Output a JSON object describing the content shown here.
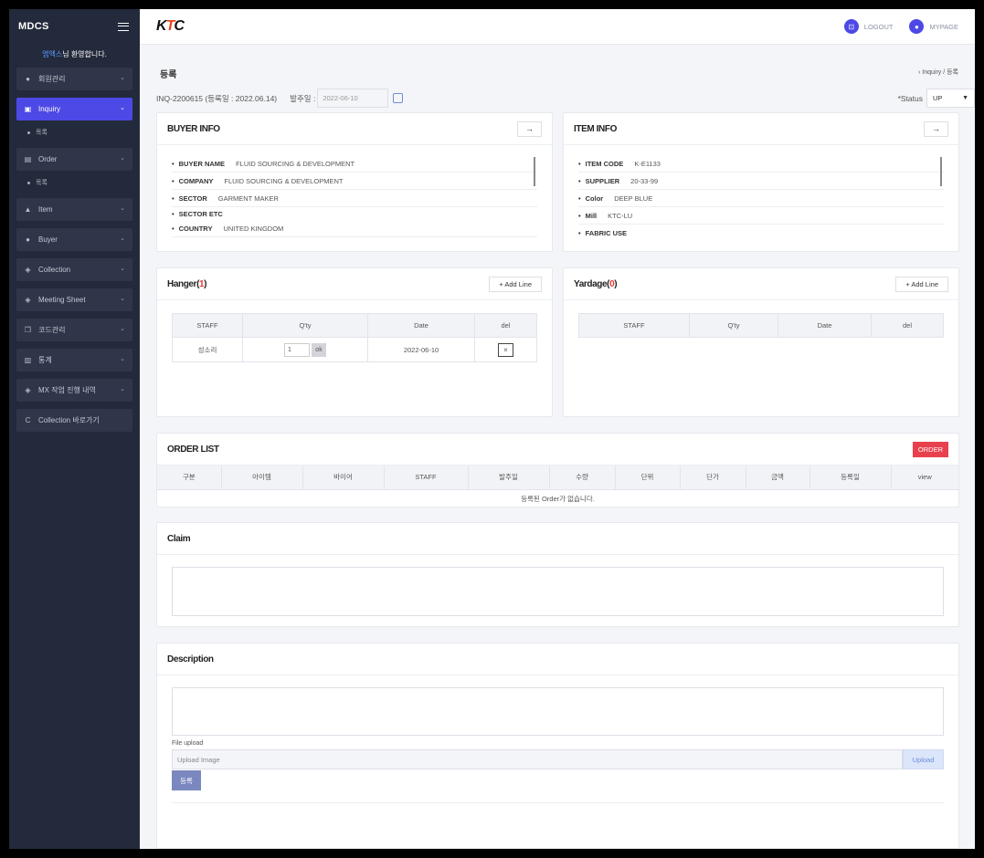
{
  "sidebar": {
    "brand": "MDCS",
    "welcome_user": "엠엑스",
    "welcome_text": "님 환영합니다.",
    "items": [
      {
        "label": "회원관리",
        "icon": "user-circle-icon"
      },
      {
        "label": "Inquiry",
        "icon": "clipboard-icon",
        "active": true,
        "sub": "목록"
      },
      {
        "label": "Order",
        "icon": "list-icon",
        "sub": "목록"
      },
      {
        "label": "Item",
        "icon": "hanger-icon"
      },
      {
        "label": "Buyer",
        "icon": "person-icon"
      },
      {
        "label": "Collection",
        "icon": "box-icon"
      },
      {
        "label": "Meeting Sheet",
        "icon": "box-icon"
      },
      {
        "label": "코드관리",
        "icon": "copy-icon"
      },
      {
        "label": "통계",
        "icon": "bar-chart-icon"
      },
      {
        "label": "MX 작업 진행 내역",
        "icon": "box-icon"
      },
      {
        "label": "Collection 바로가기",
        "icon": "c-icon"
      }
    ]
  },
  "header": {
    "logo": "KTC",
    "logout": "LOGOUT",
    "mypage": "MYPAGE"
  },
  "page": {
    "title": "등록",
    "breadcrumb": "Inquiry / 등록",
    "inquiry_no": "INQ-2200615 (등록일 : 2022.06.14)",
    "order_date_label": "발주일 :",
    "order_date_value": "2022-06-10",
    "status_label": "*Status",
    "status_value": "UP"
  },
  "buyer_info": {
    "title": "BUYER INFO",
    "rows": [
      {
        "key": "BUYER NAME",
        "value": "FLUID SOURCING & DEVELOPMENT"
      },
      {
        "key": "COMPANY",
        "value": "FLUID SOURCING & DEVELOPMENT"
      },
      {
        "key": "SECTOR",
        "value": "GARMENT MAKER"
      },
      {
        "key": "SECTOR ETC",
        "value": ""
      },
      {
        "key": "COUNTRY",
        "value": "UNITED KINGDOM"
      }
    ]
  },
  "item_info": {
    "title": "ITEM INFO",
    "rows": [
      {
        "key": "ITEM CODE",
        "value": "K-E1133"
      },
      {
        "key": "SUPPLIER",
        "value": "20-33-99"
      },
      {
        "key": "Color",
        "value": "DEEP BLUE"
      },
      {
        "key": "Mill",
        "value": "KTC-LU"
      },
      {
        "key": "FABRIC USE",
        "value": ""
      }
    ]
  },
  "hanger": {
    "title": "Hanger",
    "count": "1",
    "add_line": "+ Add Line",
    "columns": [
      "STAFF",
      "Q'ty",
      "Date",
      "del"
    ],
    "rows": [
      {
        "staff": "성소리",
        "qty": "1",
        "ok": "ok",
        "date": "2022-06-10",
        "del": "×"
      }
    ]
  },
  "yardage": {
    "title": "Yardage",
    "count": "0",
    "add_line": "+ Add Line",
    "columns": [
      "STAFF",
      "Q'ty",
      "Date",
      "del"
    ]
  },
  "order_list": {
    "title": "ORDER LIST",
    "button": "ORDER",
    "columns": [
      "구분",
      "아이템",
      "바이어",
      "STAFF",
      "발주일",
      "수량",
      "단위",
      "단가",
      "금액",
      "등록일",
      "view"
    ],
    "empty": "등록된 Order가 없습니다."
  },
  "claim": {
    "title": "Claim"
  },
  "description": {
    "title": "Description",
    "file_label": "File upload",
    "upload_placeholder": "Upload Image",
    "upload_button": "Upload",
    "register_button": "등록"
  }
}
